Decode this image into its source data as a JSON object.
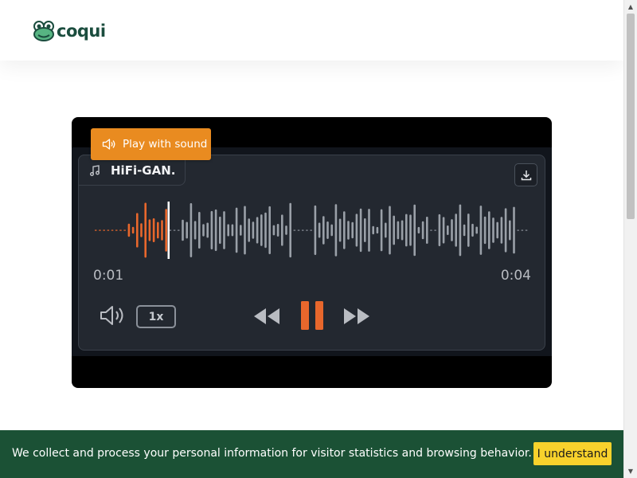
{
  "brand": {
    "name": "coqui",
    "color": "#1b4d3e"
  },
  "player": {
    "play_sound_label": "Play with sound",
    "title": "HiFi-GAN.",
    "current_time": "0:01",
    "duration": "0:04",
    "speed_label": "1x",
    "progress": 0.17,
    "state": "playing",
    "accent_color": "#e8672c",
    "icons": {
      "play_sound": "speaker-icon",
      "title": "music-note-icon",
      "download": "download-icon",
      "volume": "volume-icon",
      "rewind": "rewind-icon",
      "pause": "pause-icon",
      "forward": "fast-forward-icon"
    }
  },
  "cookie": {
    "text": "We collect and process your personal information for visitor statistics and browsing behavior. 🍪",
    "button_label": "I understand",
    "background": "#1b5135",
    "button_color": "#f8d22c"
  }
}
